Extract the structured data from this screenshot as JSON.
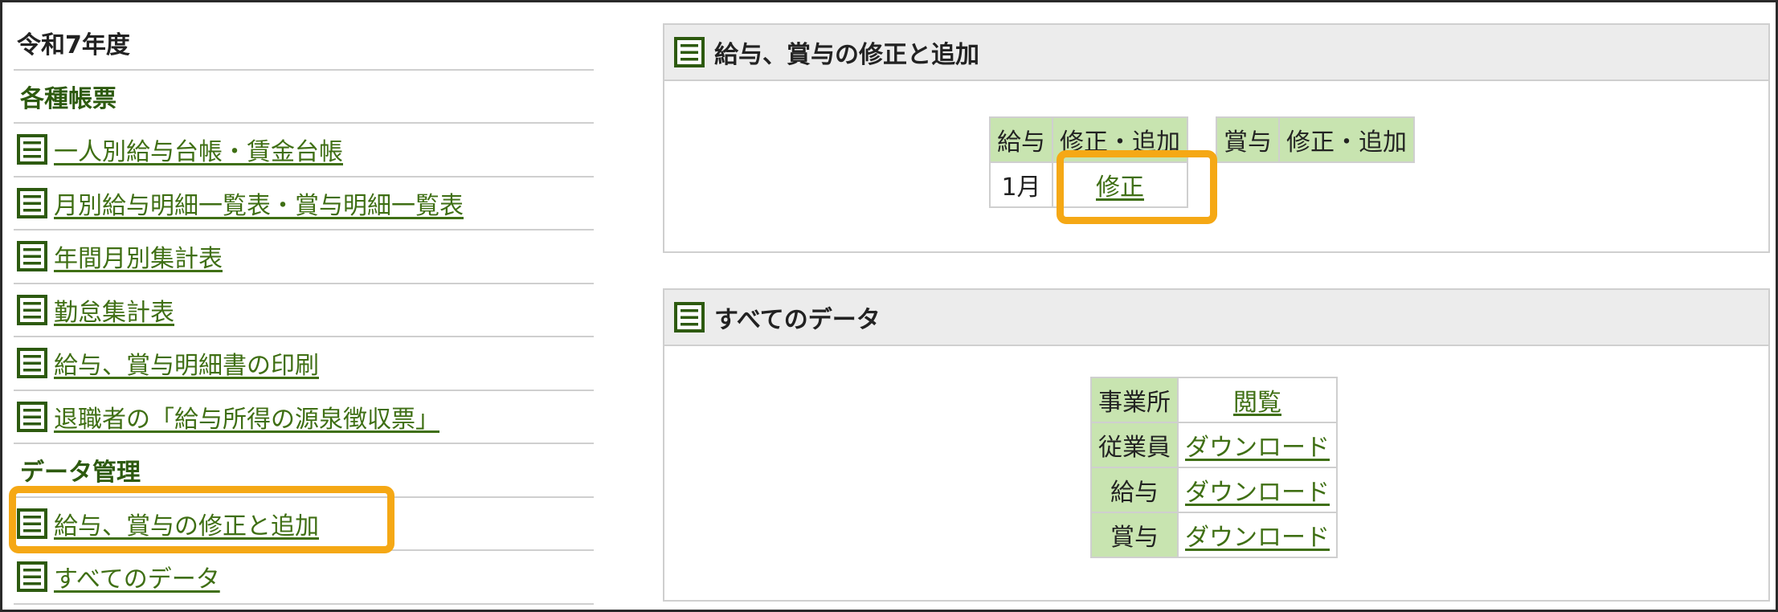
{
  "sidebar": {
    "year": "令和7年度",
    "category_reports": "各種帳票",
    "reports": [
      "一人別給与台帳・賃金台帳",
      "月別給与明細一覧表・賞与明細一覧表",
      "年間月別集計表",
      "勤怠集計表",
      "給与、賞与明細書の印刷",
      "退職者の「給与所得の源泉徴収票」"
    ],
    "category_data": "データ管理",
    "data_items": [
      "給与、賞与の修正と追加",
      "すべてのデータ"
    ]
  },
  "panel_edit": {
    "title": "給与、賞与の修正と追加",
    "salary_header": "給与",
    "salary_action_header": "修正・追加",
    "bonus_header": "賞与",
    "bonus_action_header": "修正・追加",
    "salary_rows": [
      {
        "month": "1月",
        "action": "修正"
      }
    ]
  },
  "panel_all": {
    "title": "すべてのデータ",
    "rows": [
      {
        "label": "事業所",
        "action": "閲覧"
      },
      {
        "label": "従業員",
        "action": "ダウンロード"
      },
      {
        "label": "給与",
        "action": "ダウンロード"
      },
      {
        "label": "賞与",
        "action": "ダウンロード"
      }
    ]
  },
  "icons": {
    "document": "document-list-icon"
  },
  "colors": {
    "link": "#3f6f14",
    "header_bg": "#c8e4b0",
    "highlight": "#f5a815"
  }
}
